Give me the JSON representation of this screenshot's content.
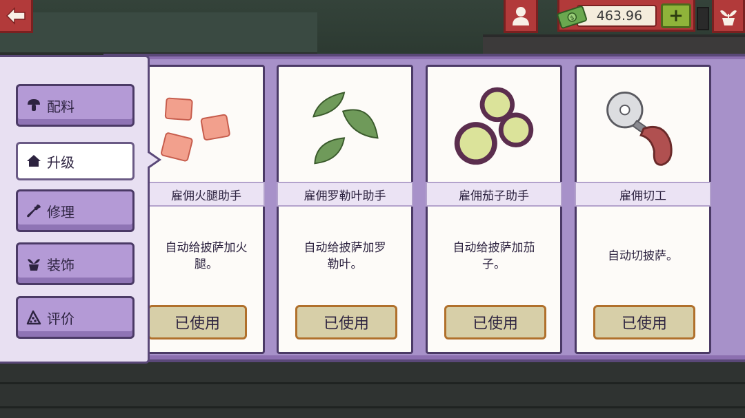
{
  "currency": {
    "amount": "463.96",
    "plus_label": "+"
  },
  "icons": {
    "back": "back-arrow-icon",
    "profile": "profile-icon",
    "money": "money-bill-icon",
    "plant": "plant-icon"
  },
  "sidebar": {
    "tabs": [
      {
        "label": "配料",
        "icon": "mushroom-icon",
        "active": false
      },
      {
        "label": "升级",
        "icon": "home-icon",
        "active": true
      },
      {
        "label": "修理",
        "icon": "wrench-icon",
        "active": false
      },
      {
        "label": "装饰",
        "icon": "plant-pot-icon",
        "active": false
      },
      {
        "label": "评价",
        "icon": "pizza-slice-icon",
        "active": false
      }
    ]
  },
  "cards": [
    {
      "title": "雇佣火腿助手",
      "desc_line1": "自动给披萨加火",
      "desc_line2": "腿。",
      "button": "已使用",
      "art": "ham-cubes"
    },
    {
      "title": "雇佣罗勒叶助手",
      "desc_line1": "自动给披萨加罗",
      "desc_line2": "勒叶。",
      "button": "已使用",
      "art": "basil-leaves"
    },
    {
      "title": "雇佣茄子助手",
      "desc_line1": "自动给披萨加茄",
      "desc_line2": "子。",
      "button": "已使用",
      "art": "eggplant-slices"
    },
    {
      "title": "雇佣切工",
      "desc_line1": "自动切披萨。",
      "desc_line2": "",
      "button": "已使用",
      "art": "pizza-cutter"
    }
  ],
  "colors": {
    "accent_red": "#b23a3a",
    "panel_purple": "#8c6fb0",
    "tab_purple": "#b49ad6",
    "button_tan": "#d7cfa8",
    "button_border": "#b0702c"
  }
}
